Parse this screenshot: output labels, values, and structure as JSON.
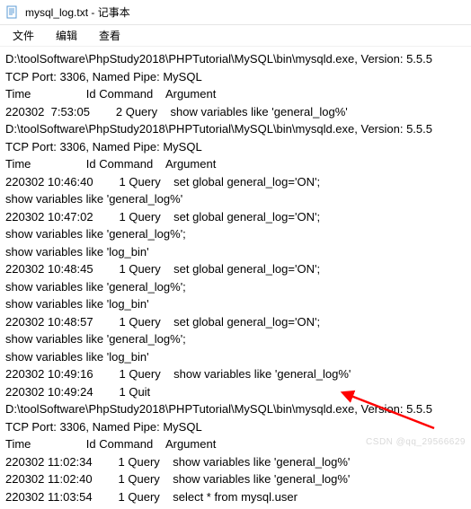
{
  "window": {
    "title": "mysql_log.txt - 记事本"
  },
  "menu": {
    "file": "文件",
    "edit": "编辑",
    "view": "查看"
  },
  "log": {
    "lines": [
      "D:\\toolSoftware\\PhpStudy2018\\PHPTutorial\\MySQL\\bin\\mysqld.exe, Version: 5.5.5",
      "TCP Port: 3306, Named Pipe: MySQL",
      "Time                 Id Command    Argument",
      "220302  7:53:05        2 Query    show variables like 'general_log%'",
      "D:\\toolSoftware\\PhpStudy2018\\PHPTutorial\\MySQL\\bin\\mysqld.exe, Version: 5.5.5",
      "TCP Port: 3306, Named Pipe: MySQL",
      "Time                 Id Command    Argument",
      "220302 10:46:40        1 Query    set global general_log='ON';",
      "show variables like 'general_log%'",
      "220302 10:47:02        1 Query    set global general_log='ON';",
      "show variables like 'general_log%';",
      "show variables like 'log_bin'",
      "220302 10:48:45        1 Query    set global general_log='ON';",
      "show variables like 'general_log%';",
      "show variables like 'log_bin'",
      "220302 10:48:57        1 Query    set global general_log='ON';",
      "show variables like 'general_log%';",
      "show variables like 'log_bin'",
      "220302 10:49:16        1 Query    show variables like 'general_log%'",
      "220302 10:49:24        1 Quit",
      "D:\\toolSoftware\\PhpStudy2018\\PHPTutorial\\MySQL\\bin\\mysqld.exe, Version: 5.5.5",
      "TCP Port: 3306, Named Pipe: MySQL",
      "Time                 Id Command    Argument",
      "220302 11:02:34        1 Query    show variables like 'general_log%'",
      "220302 11:02:40        1 Query    show variables like 'general_log%'",
      "220302 11:03:54        1 Query    select * from mysql.user"
    ]
  },
  "watermark": "CSDN @qq_29566629",
  "colors": {
    "arrow": "#ff0000"
  }
}
